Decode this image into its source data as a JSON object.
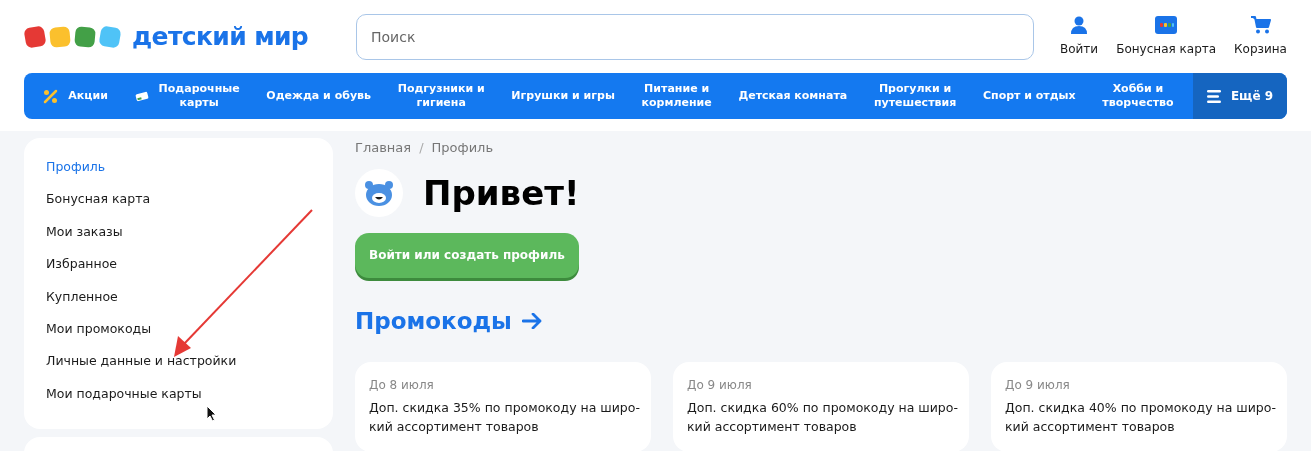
{
  "header": {
    "logo": "детский мир",
    "search": {
      "placeholder": "Поиск"
    },
    "actions": [
      {
        "kind": "user",
        "label": "Войти"
      },
      {
        "kind": "card",
        "label": "Бонусная карта"
      },
      {
        "kind": "cart",
        "label": "Корзина"
      }
    ]
  },
  "nav": {
    "items": [
      {
        "kind": "percent",
        "label": "Акции"
      },
      {
        "kind": "gift",
        "label": "Подарочные\nкарты"
      },
      {
        "label": "Одежда и обувь"
      },
      {
        "label": "Подгузники и\nгигиена"
      },
      {
        "label": "Игрушки и игры"
      },
      {
        "label": "Питание и\nкормление"
      },
      {
        "label": "Детская комната"
      },
      {
        "label": "Прогулки и\nпутешествия"
      },
      {
        "label": "Спорт и отдых"
      },
      {
        "label": "Хобби и\nтворчество"
      }
    ],
    "more": "Ещё 9"
  },
  "sidebar": {
    "items": [
      {
        "label": "Профиль",
        "selected": true
      },
      {
        "label": "Бонусная карта",
        "selected": false
      },
      {
        "label": "Мои заказы",
        "selected": false
      },
      {
        "label": "Избранное",
        "selected": false
      },
      {
        "label": "Купленное",
        "selected": false
      },
      {
        "label": "Мои промокоды",
        "selected": false
      },
      {
        "label": "Личные данные и настройки",
        "selected": false
      },
      {
        "label": "Мои подарочные карты",
        "selected": false
      }
    ]
  },
  "breadcrumbs": [
    "Главная",
    "/",
    "Профиль"
  ],
  "greeting": "Привет!",
  "login_button": "Войти или создать профиль",
  "promo_title": "Промокоды",
  "promos": [
    {
      "date": "До 8 июля",
      "lines": [
        "Доп. скидка 35% по промокоду на широ-",
        "кий ассортимент товаров"
      ]
    },
    {
      "date": "До 9 июля",
      "lines": [
        "Доп. скидка 60% по промокоду на широ-",
        "кий ассортимент товаров"
      ]
    },
    {
      "date": "До 9 июля",
      "lines": [
        "Доп. скидка 40% по промокоду на широ-",
        "кий ассортимент товаров"
      ]
    }
  ]
}
